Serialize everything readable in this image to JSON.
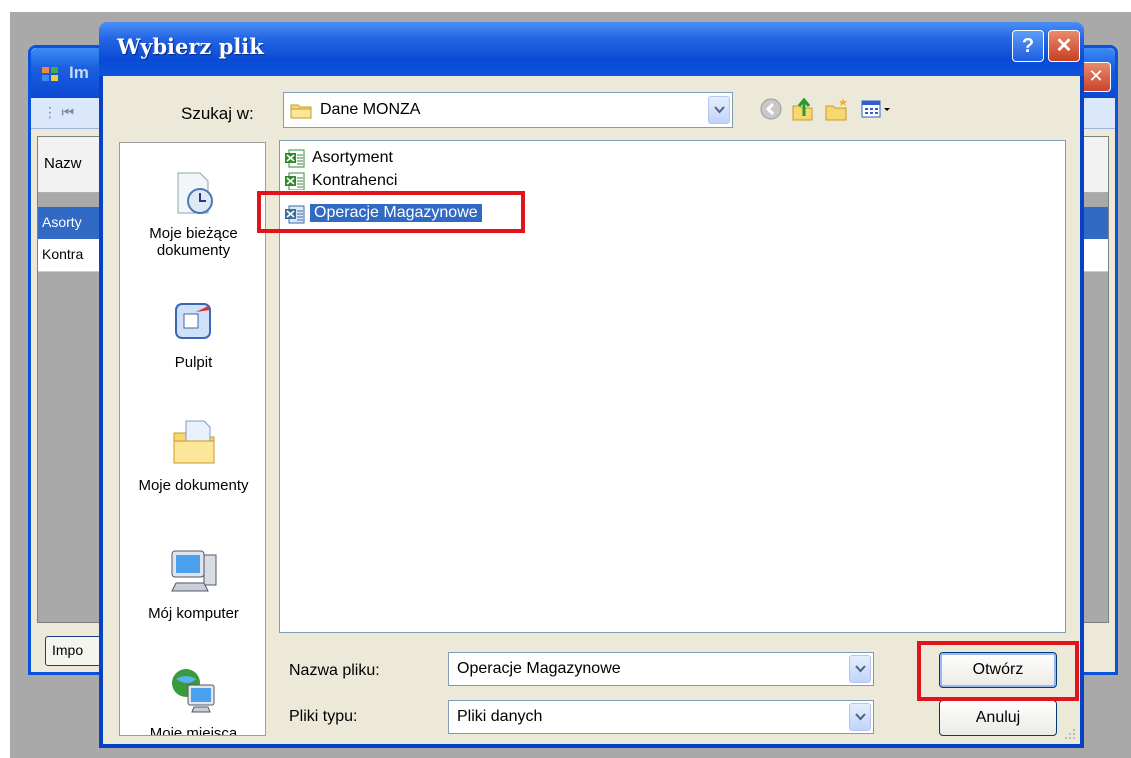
{
  "background_window": {
    "title_fragment": "Im",
    "grid_header": "Nazw",
    "rows": [
      "Asorty",
      "Kontra"
    ],
    "import_button": "Impo"
  },
  "dialog": {
    "title": "Wybierz plik",
    "help_label": "?",
    "close_label": "✕",
    "look_in": {
      "label": "Szukaj w:",
      "value": "Dane MONZA"
    },
    "places": [
      {
        "label_line1": "Moje bieżące",
        "label_line2": "dokumenty",
        "icon": "recent-documents-icon"
      },
      {
        "label_line1": "Pulpit",
        "label_line2": "",
        "icon": "desktop-icon"
      },
      {
        "label_line1": "Moje dokumenty",
        "label_line2": "",
        "icon": "my-documents-icon"
      },
      {
        "label_line1": "Mój komputer",
        "label_line2": "",
        "icon": "my-computer-icon"
      },
      {
        "label_line1": "Moje miejsca",
        "label_line2": "",
        "icon": "network-places-icon"
      }
    ],
    "files": [
      {
        "name": "Asortyment",
        "icon": "excel-file-icon",
        "selected": false
      },
      {
        "name": "Kontrahenci",
        "icon": "excel-file-icon",
        "selected": false
      },
      {
        "name": "Operacje Magazynowe",
        "icon": "excel-file-icon",
        "selected": true
      }
    ],
    "file_name": {
      "label": "Nazwa pliku:",
      "value": "Operacje Magazynowe"
    },
    "file_type": {
      "label": "Pliki typu:",
      "value": "Pliki danych"
    },
    "open_button": "Otwórz",
    "cancel_button": "Anuluj"
  },
  "colors": {
    "title_blue": "#0a4bd6",
    "selection": "#316ac5",
    "highlight_red": "#e1141c",
    "dialog_face": "#ece9d8"
  }
}
